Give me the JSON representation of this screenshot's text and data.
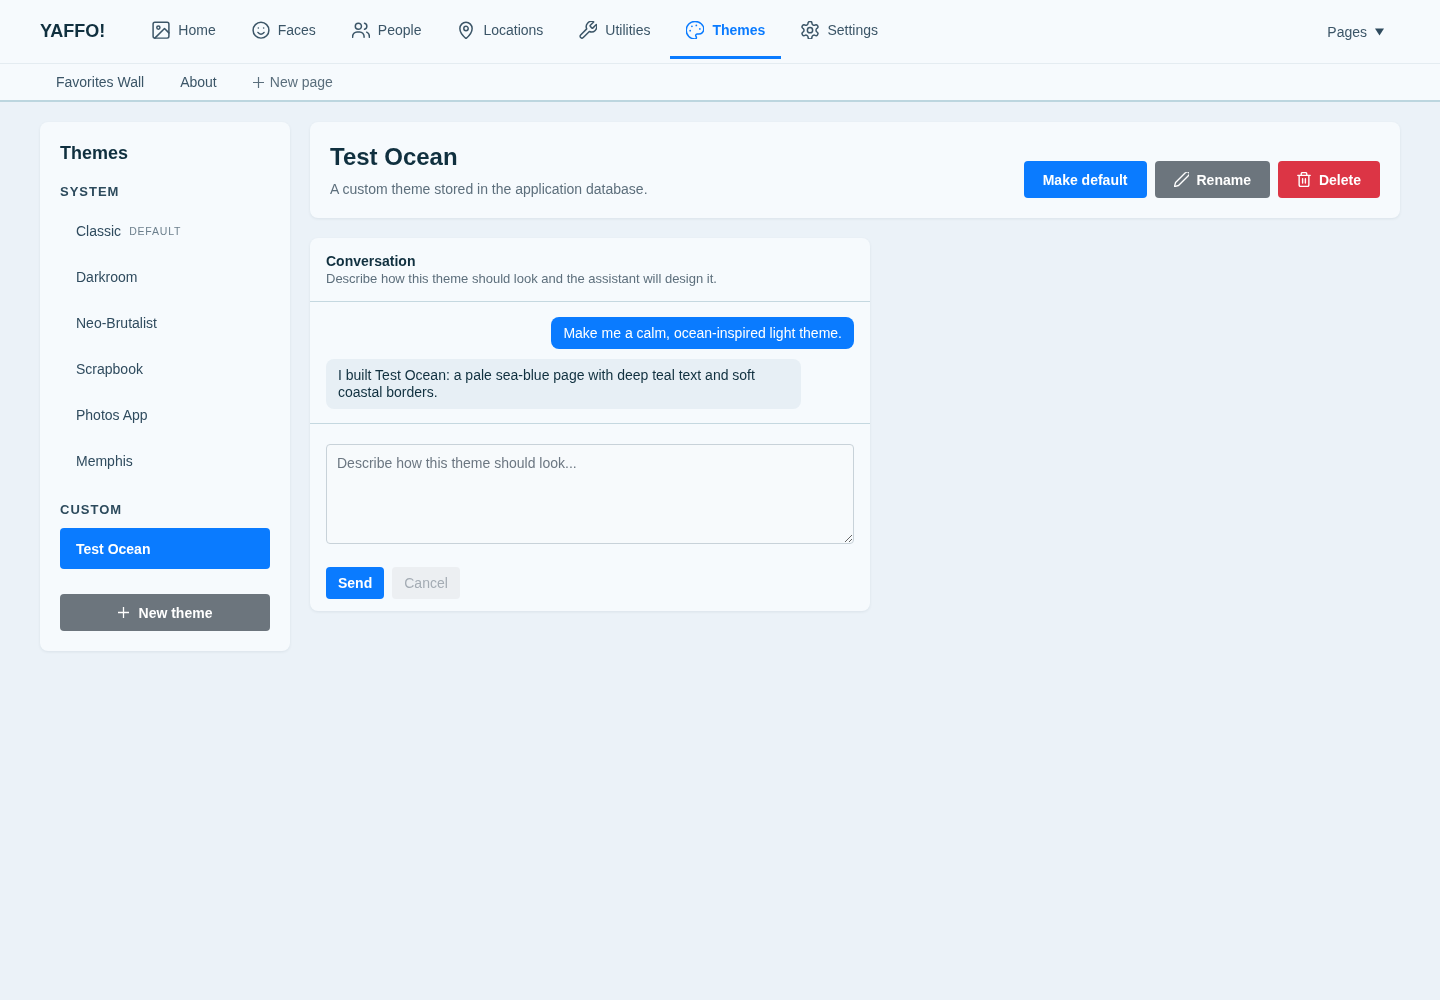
{
  "brand": "YAFFO!",
  "nav": [
    {
      "label": "Home",
      "selected": false
    },
    {
      "label": "Faces",
      "selected": false
    },
    {
      "label": "People",
      "selected": false
    },
    {
      "label": "Locations",
      "selected": false
    },
    {
      "label": "Utilities",
      "selected": false
    },
    {
      "label": "Themes",
      "selected": true
    },
    {
      "label": "Settings",
      "selected": false
    }
  ],
  "pages_menu": {
    "label": "Pages"
  },
  "subnav": [
    {
      "kind": "link",
      "label": "Favorites Wall"
    },
    {
      "kind": "link",
      "label": "About"
    },
    {
      "kind": "add",
      "label": "New page"
    }
  ],
  "sidebar": {
    "title": "Themes",
    "groups": [
      {
        "heading": "SYSTEM",
        "items": [
          {
            "label": "Classic",
            "badge": "DEFAULT",
            "selected": false
          },
          {
            "label": "Darkroom",
            "selected": false
          },
          {
            "label": "Neo-Brutalist",
            "selected": false
          },
          {
            "label": "Scrapbook",
            "selected": false
          },
          {
            "label": "Photos App",
            "selected": false
          },
          {
            "label": "Memphis",
            "selected": false
          }
        ]
      },
      {
        "heading": "CUSTOM",
        "items": [
          {
            "label": "Test Ocean",
            "selected": true
          }
        ]
      }
    ],
    "new_button": "New theme"
  },
  "header": {
    "title": "Test Ocean",
    "subtitle": "A custom theme stored in the application database.",
    "actions": [
      {
        "kind": "primary",
        "label": "Make default"
      },
      {
        "kind": "rename",
        "label": "Rename"
      },
      {
        "kind": "delete",
        "label": "Delete"
      }
    ]
  },
  "conversation": {
    "title": "Conversation",
    "subtitle": "Describe how this theme should look and the assistant will design it.",
    "messages": [
      {
        "kind": "user",
        "text": "Make me a calm, ocean-inspired light theme."
      },
      {
        "kind": "assistant",
        "text": "I built Test Ocean: a pale sea-blue page with deep teal text and soft coastal borders."
      }
    ],
    "input": {
      "placeholder": "Describe how this theme should look..."
    },
    "buttons": [
      {
        "label": "Send",
        "disabled": false
      },
      {
        "label": "Cancel",
        "disabled": true
      }
    ]
  }
}
